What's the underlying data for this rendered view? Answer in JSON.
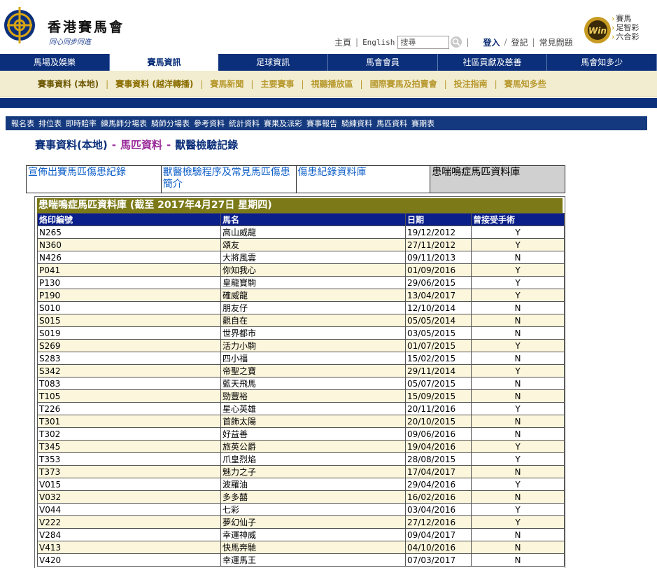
{
  "header": {
    "brand": "香港賽馬會",
    "slogan": "同心同步同進",
    "links": [
      "主頁",
      "English",
      "登入",
      "登記",
      "常見問題"
    ],
    "search_placeholder": "搜尋",
    "side_links": [
      "賽馬",
      "足智彩",
      "六合彩"
    ]
  },
  "main_nav": [
    {
      "label": "馬場及娛樂",
      "active": false
    },
    {
      "label": "賽馬資訊",
      "active": true
    },
    {
      "label": "足球資訊",
      "active": false
    },
    {
      "label": "馬會會員",
      "active": false
    },
    {
      "label": "社區貢獻及慈善",
      "active": false
    },
    {
      "label": "馬會知多少",
      "active": false
    }
  ],
  "sub_nav": [
    "賽事資料 (本地)",
    "賽事資料 (越洋轉播)",
    "賽馬新聞",
    "主要賽事",
    "視聽播放區",
    "國際賽馬及拍賣會",
    "投注指南",
    "賽馬知多些"
  ],
  "third_nav": [
    "報名表",
    "排位表",
    "即時賠率",
    "練馬師分場表",
    "騎師分場表",
    "參考資料",
    "統計資料",
    "賽果及派彩",
    "賽事報告",
    "騎練資料",
    "馬匹資料",
    "賽期表"
  ],
  "breadcrumb": {
    "level1": "賽事資料(本地)",
    "level2": "馬匹資料",
    "level3": "獸醫檢驗記錄"
  },
  "tabs": [
    "宣佈出賽馬匹傷患紀錄",
    "獸醫檢驗程序及常見馬匹傷患簡介",
    "傷患紀錄資料庫",
    "患喘鳴症馬匹資料庫"
  ],
  "table": {
    "title": "患喘鳴症馬匹資料庫 (截至 2017年4月27日 星期四)",
    "columns": [
      "烙印編號",
      "馬名",
      "日期",
      "曾接受手術"
    ],
    "rows": [
      [
        "N265",
        "高山威龍",
        "19/12/2012",
        "Y"
      ],
      [
        "N360",
        "頌友",
        "27/11/2012",
        "Y"
      ],
      [
        "N426",
        "大將風雲",
        "09/11/2013",
        "N"
      ],
      [
        "P041",
        "你知我心",
        "01/09/2016",
        "Y"
      ],
      [
        "P130",
        "皇龍寶駒",
        "29/06/2015",
        "Y"
      ],
      [
        "P190",
        "確威龍",
        "13/04/2017",
        "Y"
      ],
      [
        "S010",
        "朋友仔",
        "12/10/2014",
        "N"
      ],
      [
        "S015",
        "觀自在",
        "05/05/2014",
        "N"
      ],
      [
        "S019",
        "世界都市",
        "03/05/2015",
        "N"
      ],
      [
        "S269",
        "活力小駒",
        "01/07/2015",
        "Y"
      ],
      [
        "S283",
        "四小福",
        "15/02/2015",
        "N"
      ],
      [
        "S342",
        "帝聖之寶",
        "29/11/2014",
        "Y"
      ],
      [
        "T083",
        "藍天飛馬",
        "05/07/2015",
        "N"
      ],
      [
        "T105",
        "勁豐裕",
        "15/09/2015",
        "N"
      ],
      [
        "T226",
        "星心英雄",
        "20/11/2016",
        "Y"
      ],
      [
        "T301",
        "首飾太陽",
        "20/10/2015",
        "N"
      ],
      [
        "T302",
        "好益善",
        "09/06/2016",
        "N"
      ],
      [
        "T345",
        "旅英公爵",
        "19/04/2016",
        "Y"
      ],
      [
        "T353",
        "爪皇烈焰",
        "28/08/2015",
        "Y"
      ],
      [
        "T373",
        "魅力之子",
        "17/04/2017",
        "N"
      ],
      [
        "V015",
        "波羅油",
        "29/04/2016",
        "Y"
      ],
      [
        "V032",
        "多多囍",
        "16/02/2016",
        "N"
      ],
      [
        "V044",
        "七彩",
        "03/04/2016",
        "Y"
      ],
      [
        "V222",
        "夢幻仙子",
        "27/12/2016",
        "Y"
      ],
      [
        "V284",
        "幸運神威",
        "09/04/2017",
        "N"
      ],
      [
        "V413",
        "快馬奔馳",
        "04/10/2016",
        "N"
      ],
      [
        "V420",
        "幸運馬王",
        "07/03/2017",
        "N"
      ]
    ]
  },
  "colors": {
    "nav_blue": "#0b2f7a",
    "subnav_bg": "#f2ecd0",
    "table_title_bg": "#7c7a18",
    "table_header_bg": "#0b1f8a",
    "even_row_bg": "#fbf6dc"
  }
}
